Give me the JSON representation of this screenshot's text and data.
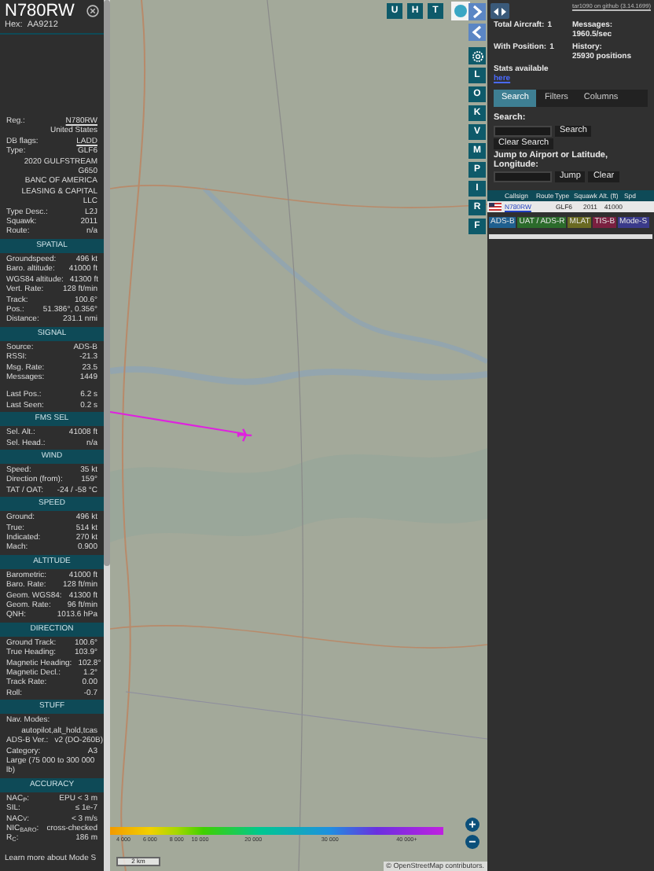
{
  "aircraft": {
    "callsign": "N780RW",
    "hex_label": "Hex:",
    "hex": "AA9212"
  },
  "info": [
    {
      "kind": "link",
      "label": "Reg.:",
      "value": "N780RW"
    },
    {
      "kind": "value",
      "value": "United States"
    },
    {
      "kind": "link",
      "label": "DB flags:",
      "value": "LADD"
    },
    {
      "kind": "row",
      "label": "Type:",
      "value": "GLF6"
    },
    {
      "kind": "value",
      "value": "2020 GULFSTREAM G650"
    },
    {
      "kind": "value",
      "value": "BANC OF AMERICA LEASING & CAPITAL LLC"
    },
    {
      "kind": "row",
      "label": "Type Desc.:",
      "value": "L2J"
    },
    {
      "kind": "row",
      "label": "Squawk:",
      "value": "2011"
    },
    {
      "kind": "row",
      "label": "Route:",
      "value": "n/a"
    }
  ],
  "sections": [
    {
      "title": "SPATIAL",
      "rows": [
        {
          "kind": "row",
          "label": "Groundspeed:",
          "value": "496 kt"
        },
        {
          "kind": "row",
          "label": "Baro. altitude:",
          "value": "41000 ft"
        },
        {
          "kind": "row",
          "label": "WGS84 altitude:",
          "value": "41300 ft"
        },
        {
          "kind": "row",
          "label": "Vert. Rate:",
          "value": "128 ft/min"
        },
        {
          "kind": "row",
          "label": "Track:",
          "value": "100.6°"
        },
        {
          "kind": "row",
          "label": "Pos.:",
          "value": "51.386°, 0.356°"
        },
        {
          "kind": "row",
          "label": "Distance:",
          "value": "231.1 nmi"
        }
      ]
    },
    {
      "title": "SIGNAL",
      "rows": [
        {
          "kind": "row",
          "label": "Source:",
          "value": "ADS-B"
        },
        {
          "kind": "row",
          "label": "RSSI:",
          "value": "-21.3"
        },
        {
          "kind": "row",
          "label": "Msg. Rate:",
          "value": "23.5"
        },
        {
          "kind": "row",
          "label": "Messages:",
          "value": "1449"
        },
        {
          "kind": "gap"
        },
        {
          "kind": "row",
          "label": "Last Pos.:",
          "value": "6.2 s"
        },
        {
          "kind": "row",
          "label": "Last Seen:",
          "value": "0.2 s"
        }
      ]
    },
    {
      "title": "FMS SEL",
      "rows": [
        {
          "kind": "row",
          "label": "Sel. Alt.:",
          "value": "41008 ft"
        },
        {
          "kind": "row",
          "label": "Sel. Head.:",
          "value": "n/a"
        }
      ]
    },
    {
      "title": "WIND",
      "rows": [
        {
          "kind": "row",
          "label": "Speed:",
          "value": "35 kt"
        },
        {
          "kind": "row",
          "label": "Direction (from):",
          "value": "159°"
        },
        {
          "kind": "row",
          "label": "TAT / OAT:",
          "value": "-24 / -58 °C"
        }
      ]
    },
    {
      "title": "SPEED",
      "rows": [
        {
          "kind": "row",
          "label": "Ground:",
          "value": "496 kt"
        },
        {
          "kind": "row",
          "label": "True:",
          "value": "514 kt"
        },
        {
          "kind": "row",
          "label": "Indicated:",
          "value": "270 kt"
        },
        {
          "kind": "row",
          "label": "Mach:",
          "value": "0.900"
        }
      ]
    },
    {
      "title": "ALTITUDE",
      "rows": [
        {
          "kind": "row",
          "label": "Barometric:",
          "value": "41000 ft"
        },
        {
          "kind": "row",
          "label": "Baro. Rate:",
          "value": "128 ft/min"
        },
        {
          "kind": "row",
          "label": "Geom. WGS84:",
          "value": "41300 ft"
        },
        {
          "kind": "row",
          "label": "Geom. Rate:",
          "value": "96 ft/min"
        },
        {
          "kind": "row",
          "label": "QNH:",
          "value": "1013.6 hPa"
        }
      ]
    },
    {
      "title": "DIRECTION",
      "rows": [
        {
          "kind": "row",
          "label": "Ground Track:",
          "value": "100.6°"
        },
        {
          "kind": "row",
          "label": "True Heading:",
          "value": "103.9°"
        },
        {
          "kind": "row",
          "label": "Magnetic Heading:",
          "value": "102.8°"
        },
        {
          "kind": "row",
          "label": "Magnetic Decl.:",
          "value": "1.2°"
        },
        {
          "kind": "row",
          "label": "Track Rate:",
          "value": "0.00"
        },
        {
          "kind": "row",
          "label": "Roll:",
          "value": "-0.7"
        }
      ]
    },
    {
      "title": "STUFF",
      "rows": [
        {
          "kind": "stack",
          "label": "Nav. Modes:",
          "value": "autopilot,alt_hold,tcas"
        },
        {
          "kind": "row",
          "label": "ADS-B Ver.:",
          "value": "v2 (DO-260B)"
        },
        {
          "kind": "row",
          "label": "Category:",
          "value": "A3"
        },
        {
          "kind": "text",
          "value": "Large (75 000 to 300 000 lb)"
        }
      ]
    },
    {
      "title": "ACCURACY",
      "rows": [
        {
          "kind": "row",
          "label": "NAC$_{P}$:",
          "value": "EPU < 3 m"
        },
        {
          "kind": "row",
          "label": "SIL:",
          "value": "≤ 1e-7"
        },
        {
          "kind": "row",
          "label": "NAC$_{V}$:",
          "value": "< 3 m/s"
        },
        {
          "kind": "row",
          "label": "NIC$_{BARO}$:",
          "value": "cross-checked"
        },
        {
          "kind": "row",
          "label": "R$_{C}$:",
          "value": "186 m"
        }
      ]
    }
  ],
  "learn_more": "Learn more about Mode S",
  "map": {
    "top_buttons": [
      "U",
      "H",
      "T"
    ],
    "side_buttons": [
      {
        "kind": "chevron-right"
      },
      {
        "kind": "chevron-left"
      },
      {
        "kind": "gear"
      },
      {
        "kind": "letter",
        "label": "L"
      },
      {
        "kind": "letter",
        "label": "O"
      },
      {
        "kind": "letter",
        "label": "K"
      },
      {
        "kind": "letter",
        "label": "V"
      },
      {
        "kind": "letter",
        "label": "M"
      },
      {
        "kind": "letter",
        "label": "P"
      },
      {
        "kind": "letter",
        "label": "I"
      },
      {
        "kind": "letter",
        "label": "R"
      },
      {
        "kind": "letter",
        "label": "F"
      }
    ],
    "altitude_legend": [
      "4 000",
      "6 000",
      "8 000",
      "10 000",
      "20 000",
      "30 000",
      "40 000+"
    ],
    "scale": "2 km",
    "zoom_in": "+",
    "zoom_out": "−",
    "attribution": "© OpenStreetMap contributors."
  },
  "sidebar": {
    "version_link": "tar1090 on github (3.14.1699)",
    "stats": [
      {
        "label": "Total Aircraft:",
        "value": "1"
      },
      {
        "label": "Messages:",
        "value": "1960.5/sec"
      },
      {
        "label": "With Position:",
        "value": "1"
      },
      {
        "label": "History:",
        "value": "25930 positions"
      }
    ],
    "stats_text": "Stats available",
    "stats_link": "here",
    "tabs": [
      {
        "label": "Search",
        "selected": true
      },
      {
        "label": "Filters",
        "selected": false
      },
      {
        "label": "Columns",
        "selected": false
      }
    ],
    "search_label": "Search:",
    "search_button": "Search",
    "clear_search_button": "Clear Search",
    "jump_label": "Jump to Airport or Latitude, Longitude:",
    "jump_button": "Jump",
    "clear_button": "Clear",
    "table": {
      "columns": [
        "Callsign",
        "Route",
        "Type",
        "Squawk",
        "Alt. (ft)",
        "Spd"
      ],
      "rows": [
        {
          "callsign": "N780RW",
          "type": "GLF6",
          "squawk": "2011",
          "altitude": "41000"
        }
      ]
    },
    "legend": [
      {
        "label": "ADS-B",
        "color": "#1f5f8f"
      },
      {
        "label": "UAT / ADS-R",
        "color": "#2b6b2b"
      },
      {
        "label": "MLAT",
        "color": "#6a6a22"
      },
      {
        "label": "TIS-B",
        "color": "#7a2040"
      },
      {
        "label": "Mode-S",
        "color": "#3a3a8a"
      }
    ]
  }
}
